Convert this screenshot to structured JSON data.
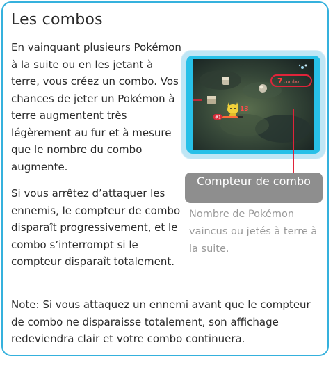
{
  "section": {
    "title": "Les combos",
    "paragraph1": "En vainquant plusieurs Pokémon à la suite ou en les jetant à terre, vous créez un combo. Vos chances de jeter un Pokémon à terre augmentent très légèrement au fur et à mesure que le nombre du combo augmente.",
    "paragraph2": "Si vous arrêtez d’attaquer les ennemis, le compteur de combo disparaît progressivement, et le combo s’interrompt si le compteur disparaît totalement.",
    "note": "Note: Si vous attaquez un ennemi avant que le compteur de combo ne disparaisse totalement, son affichage redeviendra clair et votre combo continuera."
  },
  "screenshot": {
    "combo_number": "7",
    "combo_word": "combo!",
    "damage_number": "13",
    "player_tag": "#1"
  },
  "callout": {
    "label": "Compteur de combo",
    "caption": "Nombre de Pokémon vaincus ou jetés à terre à la suite."
  },
  "colors": {
    "frame_border": "#35b1dd",
    "highlight": "#e0243a",
    "label_bg": "#8e8e8e",
    "caption_text": "#9a9a9a"
  }
}
